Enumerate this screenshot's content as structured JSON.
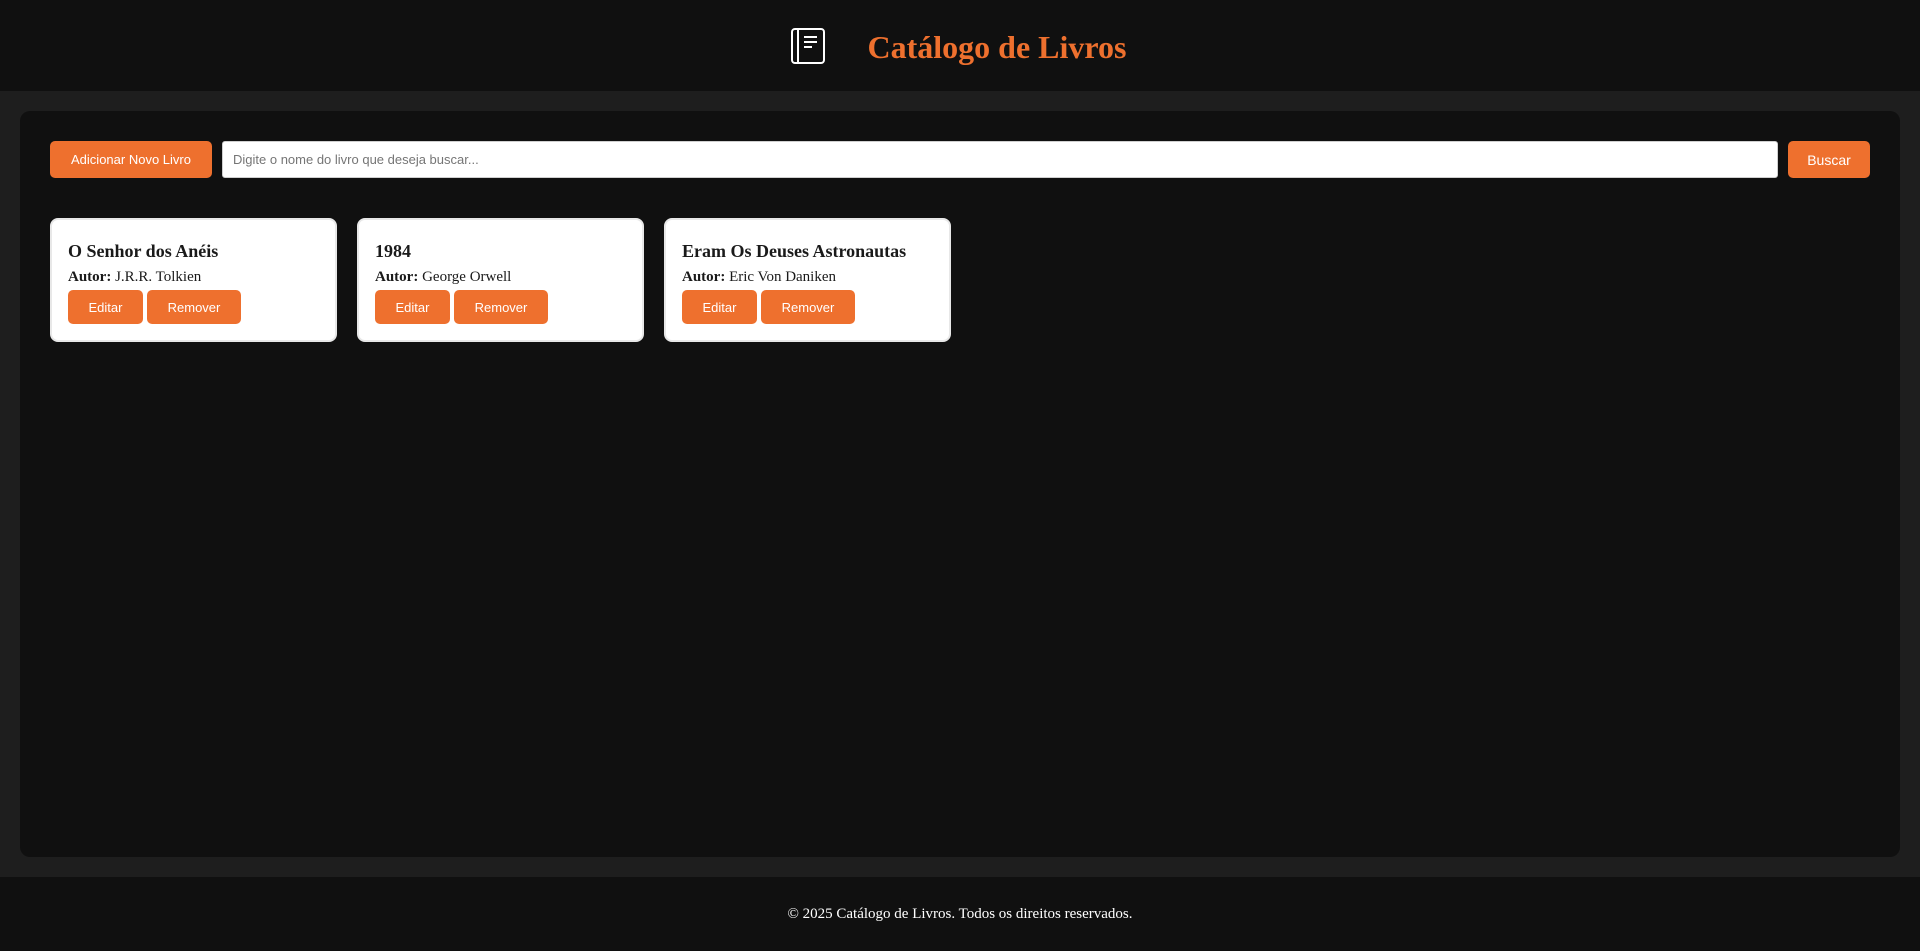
{
  "header": {
    "logo_icon": "book-icon",
    "title": "Catálogo de Livros"
  },
  "toolbar": {
    "add_label": "Adicionar Novo Livro",
    "search_placeholder": "Digite o nome do livro que deseja buscar...",
    "search_value": "",
    "search_label": "Buscar"
  },
  "books": [
    {
      "title": "O Senhor dos Anéis",
      "author_label": "Autor:",
      "author": "J.R.R. Tolkien",
      "edit_label": "Editar",
      "remove_label": "Remover"
    },
    {
      "title": "1984",
      "author_label": "Autor:",
      "author": "George Orwell",
      "edit_label": "Editar",
      "remove_label": "Remover"
    },
    {
      "title": "Eram Os Deuses Astronautas",
      "author_label": "Autor:",
      "author": "Eric Von Daniken",
      "edit_label": "Editar",
      "remove_label": "Remover"
    }
  ],
  "footer": {
    "text": "© 2025 Catálogo de Livros. Todos os direitos reservados."
  },
  "colors": {
    "accent": "#ee702e",
    "background": "#1e1e1e",
    "panel": "#101010",
    "card": "#ffffff"
  }
}
